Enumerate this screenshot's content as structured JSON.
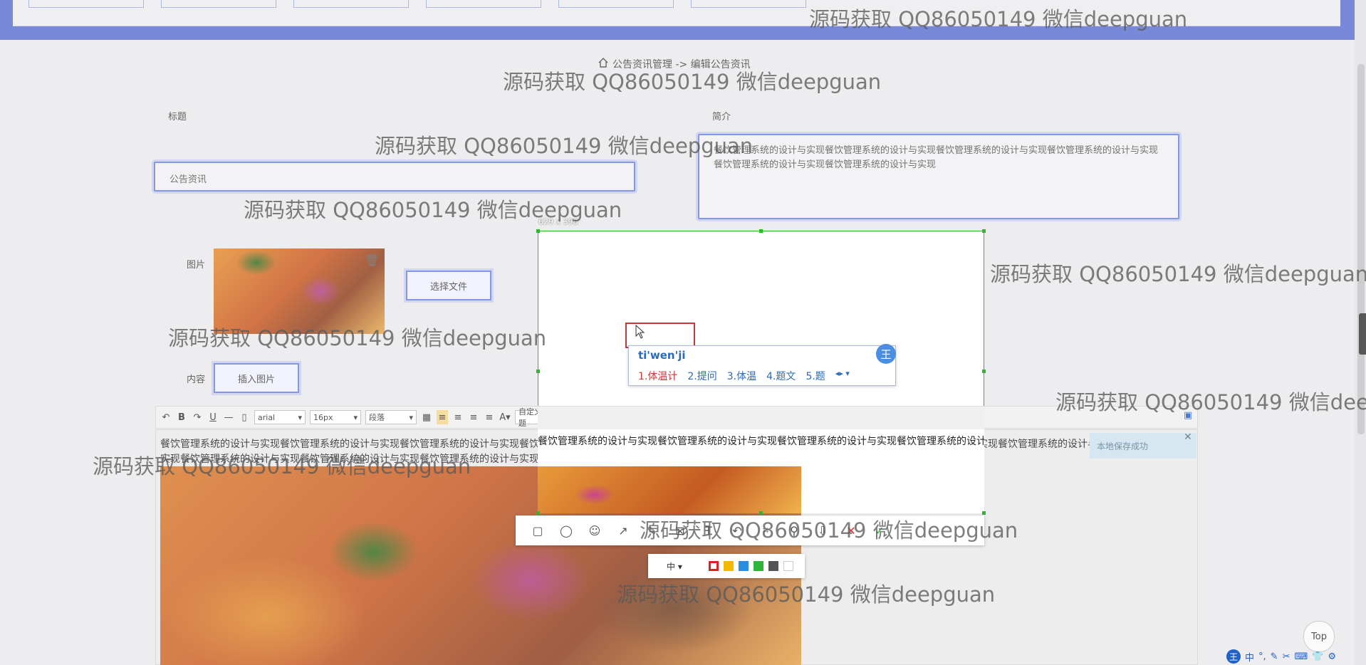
{
  "watermark": "源码获取 QQ86050149 微信deepguan",
  "breadcrumb": {
    "home_icon": "home-icon",
    "path": "公告资讯管理 -> 编辑公告资讯"
  },
  "form": {
    "title_label": "标题",
    "title_value": "公告资讯",
    "summary_label": "简介",
    "summary_value": "餐饮管理系统的设计与实现餐饮管理系统的设计与实现餐饮管理系统的设计与实现餐饮管理系统的设计与实现餐饮管理系统的设计与实现餐饮管理系统的设计与实现",
    "image_label": "图片",
    "choose_file_label": "选择文件",
    "content_label": "内容",
    "insert_image_label": "插入图片"
  },
  "editor": {
    "font_family": "arial",
    "font_size": "16px",
    "paragraph": "段落",
    "custom_title": "自定义标题",
    "text": "餐饮管理系统的设计与实现餐饮管理系统的设计与实现餐饮管理系统的设计与实现餐饮管理系统的设计与实现餐饮管理系统的设计与实现餐饮管理系统的设计与实现餐饮管理系统的设计与实现餐饮管理系统的设计与实现餐饮管理系统的设计与实现餐饮管理系统的设计与实现餐饮管理系统的设计与实现餐饮管理系统的设计与实现",
    "save_notice": "本地保存成功"
  },
  "screenshot_tool": {
    "size_label": "629 x 398",
    "font_size_label": "中",
    "colors": [
      "#e02020",
      "#f5b800",
      "#2a8ee0",
      "#2fb53a",
      "#555555",
      "#ffffff"
    ]
  },
  "ime": {
    "input": "ti'wen'ji",
    "badge": "王",
    "candidates": [
      "1.体温计",
      "2.提问",
      "3.体温",
      "4.题文",
      "5.题"
    ]
  },
  "top_button": "Top",
  "tray": {
    "lang": "中"
  }
}
